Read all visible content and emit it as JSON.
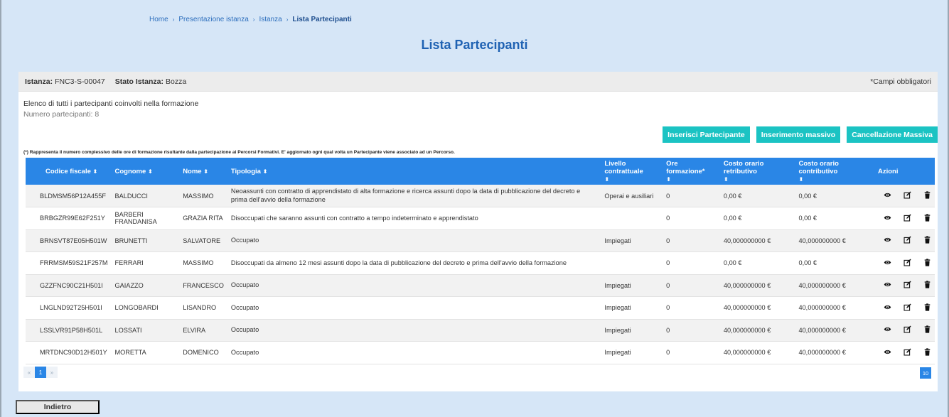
{
  "breadcrumb": {
    "home": "Home",
    "presentazione": "Presentazione istanza",
    "istanza": "Istanza",
    "current": "Lista Partecipanti",
    "sep": "›"
  },
  "title": "Lista Partecipanti",
  "panel": {
    "istanza_label": "Istanza:",
    "istanza_value": "FNC3-S-00047",
    "stato_label": "Stato Istanza:",
    "stato_value": "Bozza",
    "required_note": "*Campi obbligatori",
    "description": "Elenco di tutti i partecipanti coinvolti nella formazione",
    "count": "Numero partecipanti: 8",
    "footnote": "(*) Rappresenta il numero complessivo delle ore di formazione risultante dalla partecipazione ai Percorsi Formativi. E' aggiornato ogni qual volta un Partecipante viene associato ad un Percorso."
  },
  "buttons": {
    "inserisci": "Inserisci Partecipante",
    "massivo": "Inserimento massivo",
    "cancellazione": "Cancellazione Massiva",
    "indietro": "Indietro"
  },
  "table": {
    "headers": [
      "Codice fiscale",
      "Cognome",
      "Nome",
      "Tipologia",
      "Livello contrattuale",
      "Ore formazione*",
      "Costo orario retributivo",
      "Costo orario contributivo",
      "Azioni"
    ],
    "sort_icon": "⬍",
    "rows": [
      [
        "BLDMSM56P12A455F",
        "BALDUCCI",
        "MASSIMO",
        "Neoassunti con contratto di apprendistato di alta formazione e ricerca assunti dopo la data di pubblicazione del decreto e prima dell'avvio della formazione",
        "Operai e ausiliari",
        "0",
        "0,00 €",
        "0,00 €"
      ],
      [
        "BRBGZR99E62F251Y",
        "BARBERI FRANDANISA",
        "GRAZIA RITA",
        "Disoccupati che saranno assunti con contratto a tempo indeterminato e apprendistato",
        "",
        "0",
        "0,00 €",
        "0,00 €"
      ],
      [
        "BRNSVT87E05H501W",
        "BRUNETTI",
        "SALVATORE",
        "Occupato",
        "Impiegati",
        "0",
        "40,000000000 €",
        "40,000000000 €"
      ],
      [
        "FRRMSM59S21F257M",
        "FERRARI",
        "MASSIMO",
        "Disoccupati da almeno 12 mesi assunti dopo la data di pubblicazione del decreto e prima dell'avvio della formazione",
        "",
        "0",
        "0,00 €",
        "0,00 €"
      ],
      [
        "GZZFNC90C21H501I",
        "GAIAZZO",
        "FRANCESCO",
        "Occupato",
        "Impiegati",
        "0",
        "40,000000000 €",
        "40,000000000 €"
      ],
      [
        "LNGLND92T25H501I",
        "LONGOBARDI",
        "LISANDRO",
        "Occupato",
        "Impiegati",
        "0",
        "40,000000000 €",
        "40,000000000 €"
      ],
      [
        "LSSLVR91P58H501L",
        "LOSSATI",
        "ELVIRA",
        "Occupato",
        "Impiegati",
        "0",
        "40,000000000 €",
        "40,000000000 €"
      ],
      [
        "MRTDNC90D12H501Y",
        "MORETTA",
        "DOMENICO",
        "Occupato",
        "Impiegati",
        "0",
        "40,000000000 €",
        "40,000000000 €"
      ]
    ],
    "action_icons": [
      "eye-icon",
      "edit-icon",
      "trash-icon"
    ]
  },
  "pagination": {
    "prev": "«",
    "page": "1",
    "next": "»",
    "per_page": "10"
  },
  "colors": {
    "accent": "#2a86e6",
    "button": "#1bc3c3",
    "title": "#1f62b3",
    "background": "#d6e6f7"
  }
}
